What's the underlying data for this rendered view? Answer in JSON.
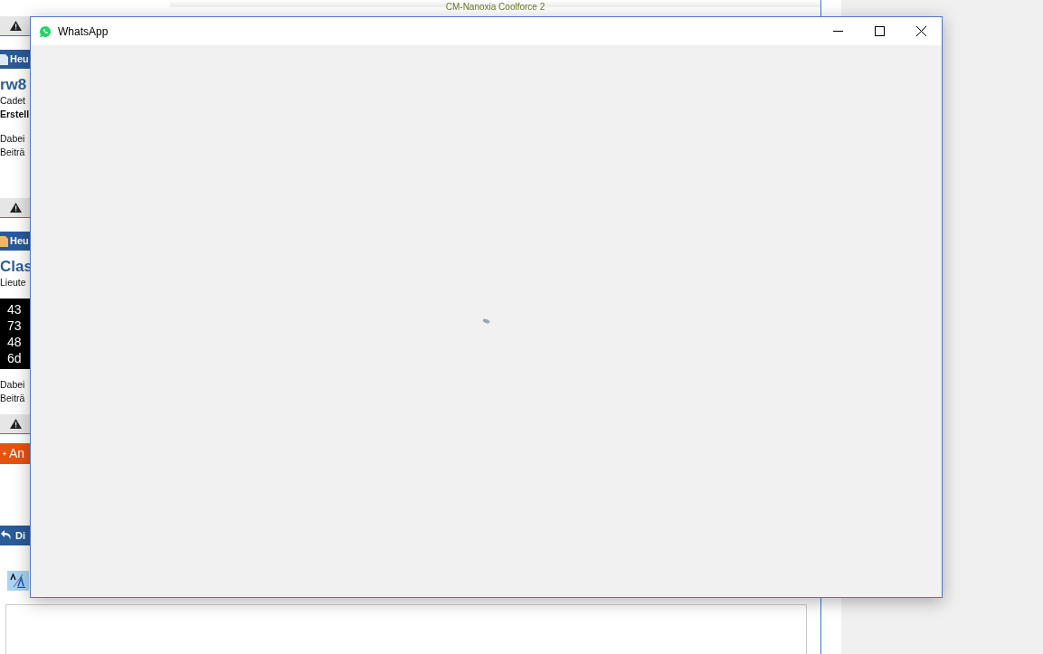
{
  "forum_page": {
    "top_text": "CM-Nanoxia Coolforce 2",
    "posts": [
      {
        "header": "Heu",
        "color": "#dce8f6",
        "username": "rw8",
        "rank": "Cadet",
        "bold_line": "Erstell",
        "meta": [
          "Dabei",
          "Beiträ"
        ]
      },
      {
        "header": "Heu",
        "color": "#f6b560",
        "username": "Clas",
        "rank": "Lieute",
        "code_lines": [
          "43",
          "73",
          "48",
          "6d"
        ],
        "meta": [
          "Dabei",
          "Beiträ"
        ]
      }
    ],
    "reply_button": "An",
    "back_bar": "Di"
  },
  "window": {
    "title": "WhatsApp",
    "loading": true
  }
}
